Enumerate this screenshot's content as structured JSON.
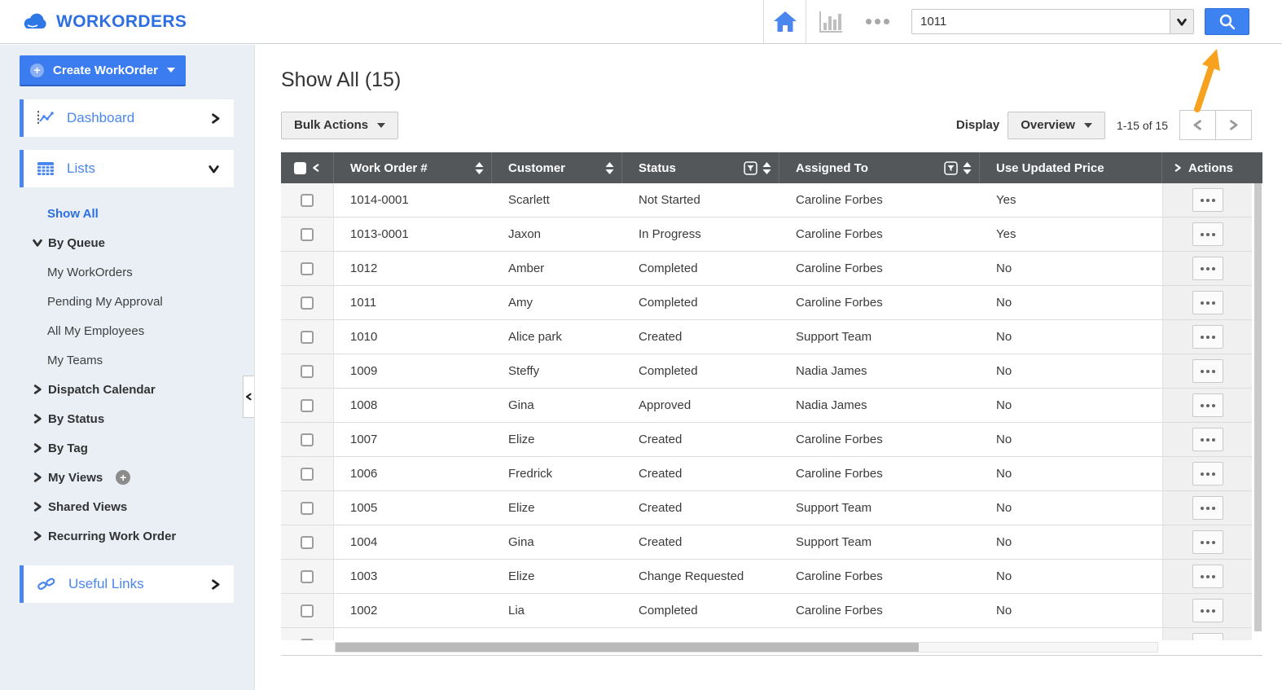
{
  "topbar": {
    "app_title": "WORKORDERS",
    "search": {
      "value": "1011"
    }
  },
  "sidebar": {
    "create_button_label": "Create WorkOrder",
    "dashboard_label": "Dashboard",
    "lists_label": "Lists",
    "useful_links_label": "Useful Links",
    "items": [
      {
        "label": "Show All",
        "style": "active"
      },
      {
        "label": "By Queue",
        "style": "group",
        "chevron": "down"
      },
      {
        "label": "My WorkOrders",
        "style": "child"
      },
      {
        "label": "Pending My Approval",
        "style": "child"
      },
      {
        "label": "All My Employees",
        "style": "child"
      },
      {
        "label": "My Teams",
        "style": "child"
      },
      {
        "label": "Dispatch Calendar",
        "style": "group",
        "chevron": "right"
      },
      {
        "label": "By Status",
        "style": "group",
        "chevron": "right"
      },
      {
        "label": "By Tag",
        "style": "group",
        "chevron": "right"
      },
      {
        "label": "My Views",
        "style": "group",
        "chevron": "right",
        "plus": true
      },
      {
        "label": "Shared Views",
        "style": "group",
        "chevron": "right"
      },
      {
        "label": "Recurring Work Order",
        "style": "group",
        "chevron": "right"
      }
    ]
  },
  "main": {
    "title": "Show All (15)",
    "bulk_actions_label": "Bulk Actions",
    "display_label": "Display",
    "display_value": "Overview",
    "range_text": "1-15 of 15"
  },
  "table": {
    "columns": [
      {
        "label": "Work Order #",
        "sort": true
      },
      {
        "label": "Customer",
        "sort": true
      },
      {
        "label": "Status",
        "filter": true,
        "sort": true
      },
      {
        "label": "Assigned To",
        "filter": true,
        "sort": true
      },
      {
        "label": "Use Updated Price"
      },
      {
        "label": "Actions"
      }
    ],
    "rows": [
      {
        "work_order": "1014-0001",
        "customer": "Scarlett",
        "status": "Not Started",
        "assigned_to": "Caroline Forbes",
        "use_updated_price": "Yes"
      },
      {
        "work_order": "1013-0001",
        "customer": "Jaxon",
        "status": "In Progress",
        "assigned_to": "Caroline Forbes",
        "use_updated_price": "Yes"
      },
      {
        "work_order": "1012",
        "customer": "Amber",
        "status": "Completed",
        "assigned_to": "Caroline Forbes",
        "use_updated_price": "No"
      },
      {
        "work_order": "1011",
        "customer": "Amy",
        "status": "Completed",
        "assigned_to": "Caroline Forbes",
        "use_updated_price": "No"
      },
      {
        "work_order": "1010",
        "customer": "Alice park",
        "status": "Created",
        "assigned_to": "Support Team",
        "use_updated_price": "No"
      },
      {
        "work_order": "1009",
        "customer": "Steffy",
        "status": "Completed",
        "assigned_to": "Nadia James",
        "use_updated_price": "No"
      },
      {
        "work_order": "1008",
        "customer": "Gina",
        "status": "Approved",
        "assigned_to": "Nadia James",
        "use_updated_price": "No"
      },
      {
        "work_order": "1007",
        "customer": "Elize",
        "status": "Created",
        "assigned_to": "Caroline Forbes",
        "use_updated_price": "No"
      },
      {
        "work_order": "1006",
        "customer": "Fredrick",
        "status": "Created",
        "assigned_to": "Caroline Forbes",
        "use_updated_price": "No"
      },
      {
        "work_order": "1005",
        "customer": "Elize",
        "status": "Created",
        "assigned_to": "Support Team",
        "use_updated_price": "No"
      },
      {
        "work_order": "1004",
        "customer": "Gina",
        "status": "Created",
        "assigned_to": "Support Team",
        "use_updated_price": "No"
      },
      {
        "work_order": "1003",
        "customer": "Elize",
        "status": "Change Requested",
        "assigned_to": "Caroline Forbes",
        "use_updated_price": "No"
      },
      {
        "work_order": "1002",
        "customer": "Lia",
        "status": "Completed",
        "assigned_to": "Caroline Forbes",
        "use_updated_price": "No"
      }
    ]
  },
  "icons": {
    "logo": "cloud-icon",
    "home": "home-icon",
    "reports": "bar-chart-icon",
    "more": "ellipsis-icon",
    "search": "search-icon",
    "sort": "sort-icon",
    "filter": "filter-icon",
    "row_menu": "ellipsis-icon",
    "annotation": "orange-arrow"
  },
  "colors": {
    "accent_blue": "#3b7cf0",
    "link_blue": "#2d6fe3",
    "table_header_gray": "#54575a",
    "sidebar_bg": "#e9eff5",
    "annotation_orange": "#f6a21e"
  }
}
